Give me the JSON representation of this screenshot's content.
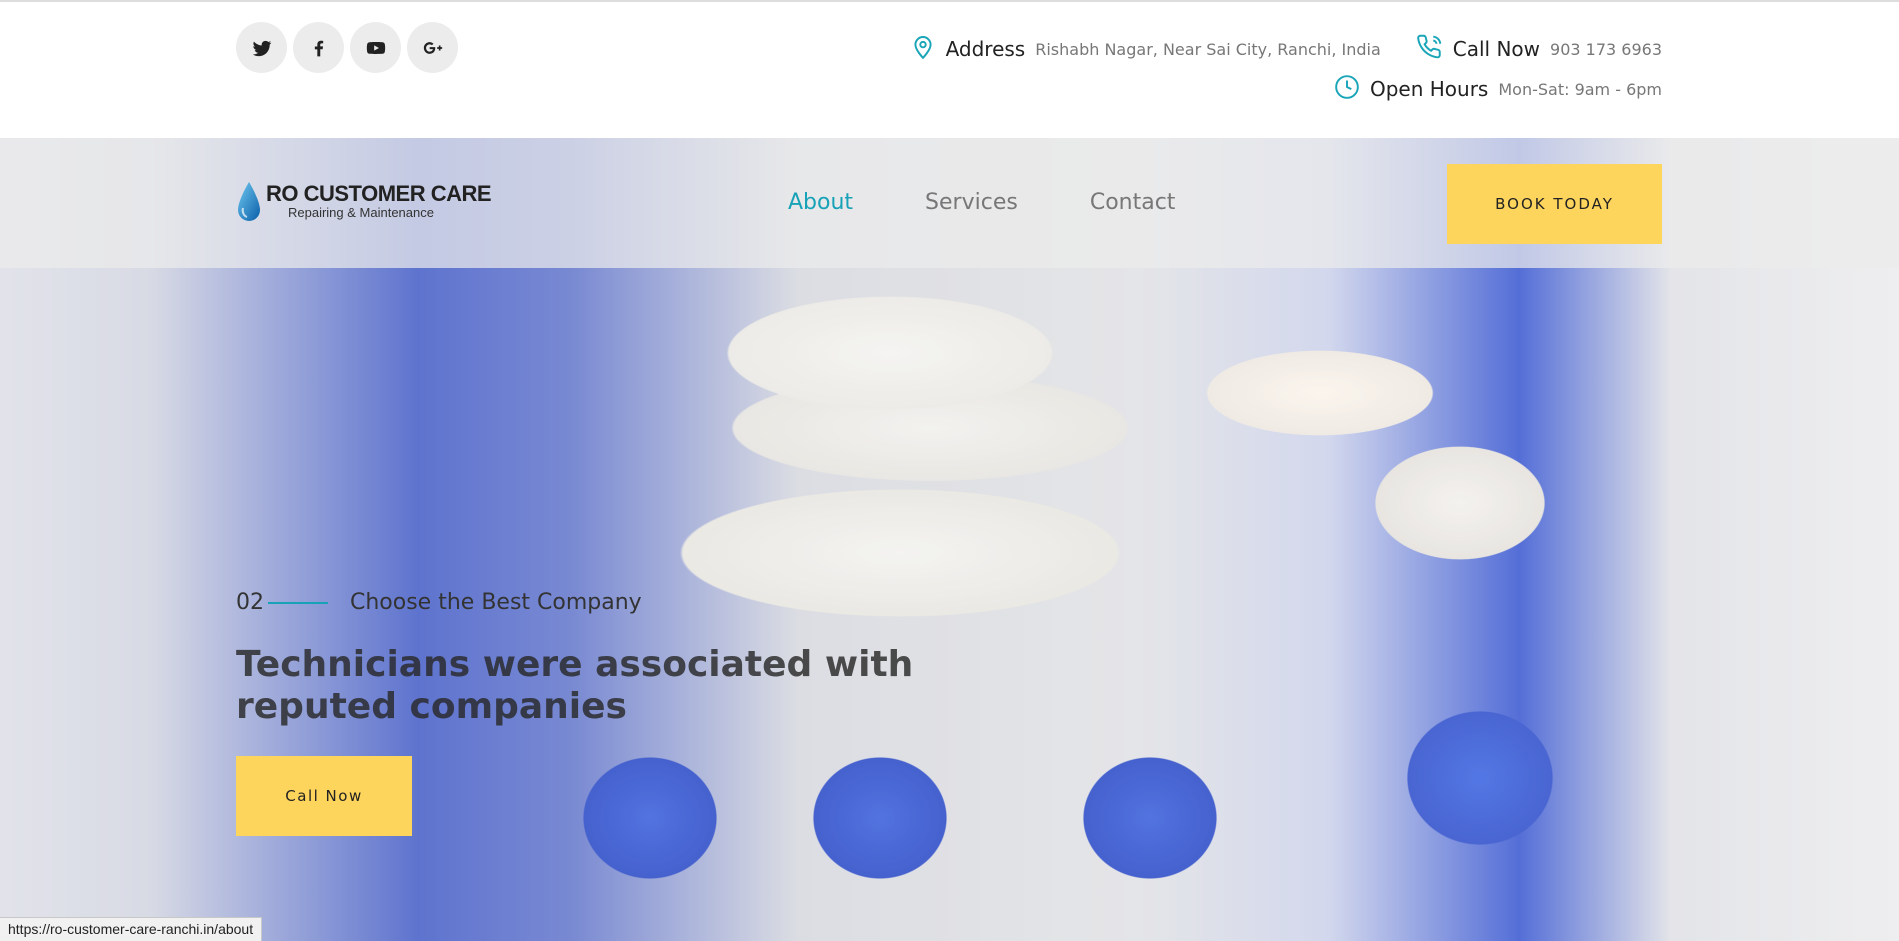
{
  "top": {
    "socials": [
      {
        "icon": "twitter-icon"
      },
      {
        "icon": "facebook-icon"
      },
      {
        "icon": "youtube-icon"
      },
      {
        "icon": "google-plus-icon"
      }
    ],
    "address_label": "Address",
    "address_value": "Rishabh Nagar, Near Sai City, Ranchi, India",
    "call_label": "Call Now",
    "call_value": "903 173 6963",
    "hours_label": "Open Hours",
    "hours_value": "Mon-Sat: 9am - 6pm"
  },
  "nav": {
    "logo_title": "RO CUSTOMER CARE",
    "logo_subtitle": "Repairing & Maintenance",
    "items": [
      {
        "label": "About",
        "active": true
      },
      {
        "label": "Services",
        "active": false
      },
      {
        "label": "Contact",
        "active": false
      }
    ],
    "book_button": "BOOK TODAY"
  },
  "hero": {
    "slide_number": "02",
    "slide_tagline": "Choose the Best Company",
    "headline": "Technicians were associated with reputed companies",
    "cta_button": "Call Now"
  },
  "status_bar": {
    "url": "https://ro-customer-care-ranchi.in/about"
  },
  "colors": {
    "accent": "#17a2b8",
    "button": "#fdd55c"
  }
}
